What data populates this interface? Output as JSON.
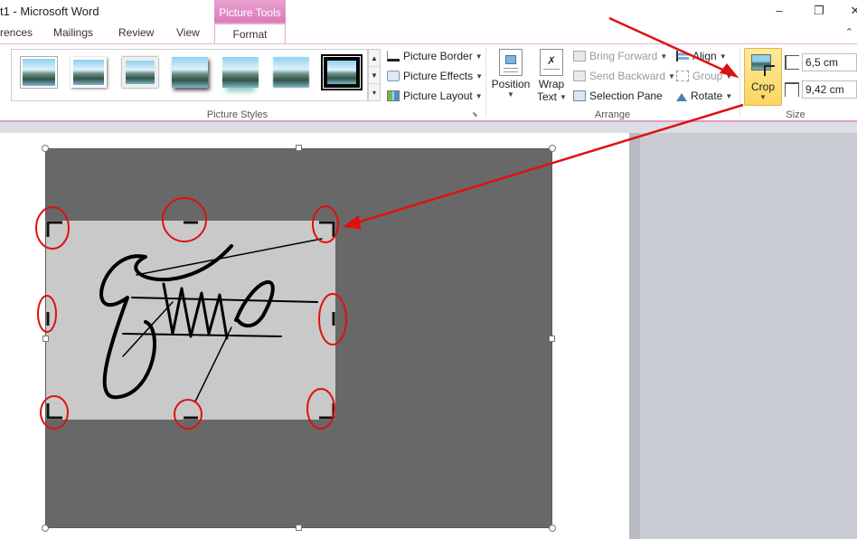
{
  "window": {
    "title": "t1 - Microsoft Word",
    "contextual_tab": "Picture Tools"
  },
  "tabs": [
    {
      "label": "rences"
    },
    {
      "label": "Mailings"
    },
    {
      "label": "Review"
    },
    {
      "label": "View"
    },
    {
      "label": "Format",
      "active": true
    }
  ],
  "ribbon": {
    "picture_styles": {
      "label": "Picture Styles",
      "picture_border": "Picture Border",
      "picture_effects": "Picture Effects",
      "picture_layout": "Picture Layout"
    },
    "arrange": {
      "label": "Arrange",
      "position": "Position",
      "wrap_text_line1": "Wrap",
      "wrap_text_line2": "Text",
      "bring_forward": "Bring Forward",
      "send_backward": "Send Backward",
      "selection_pane": "Selection Pane",
      "align": "Align",
      "group": "Group",
      "rotate": "Rotate"
    },
    "size": {
      "label": "Size",
      "crop": "Crop",
      "height": "6,5 cm",
      "width": "9,42 cm"
    }
  },
  "colors": {
    "context_tab": "#dc7ab9",
    "annotation": "#e01010",
    "crop_active": "#fbd561"
  },
  "icons": [
    "minimize-icon",
    "restore-icon",
    "close-icon",
    "ribbon-collapse-icon",
    "picture-border-icon",
    "picture-effects-icon",
    "picture-layout-icon",
    "position-icon",
    "wrap-text-icon",
    "bring-forward-icon",
    "send-backward-icon",
    "selection-pane-icon",
    "align-icon",
    "group-icon",
    "rotate-icon",
    "crop-icon",
    "height-icon",
    "width-icon"
  ]
}
